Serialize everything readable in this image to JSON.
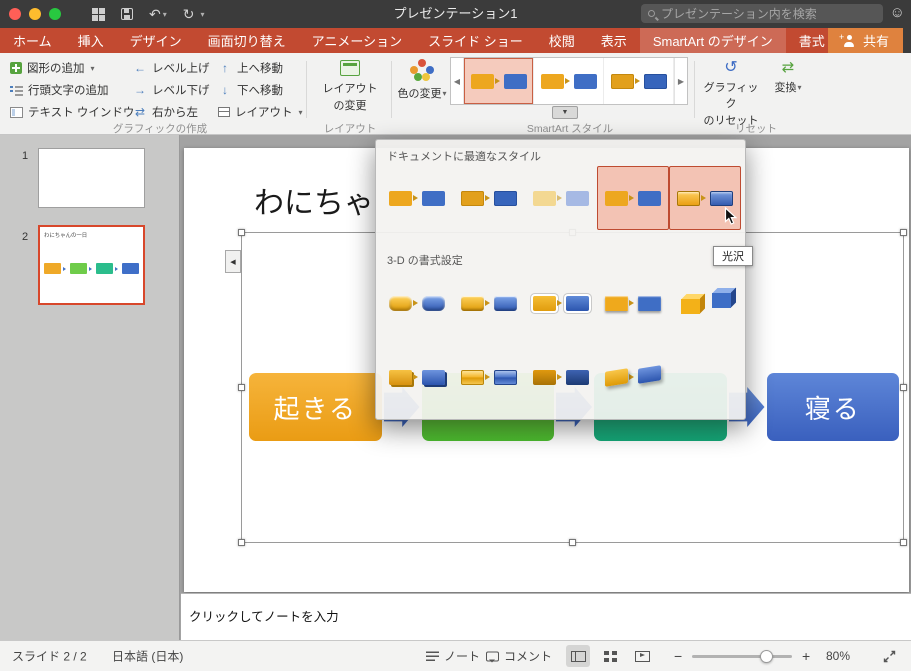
{
  "titlebar": {
    "title": "プレゼンテーション1",
    "search_placeholder": "プレゼンテーション内を検索"
  },
  "tabs": [
    {
      "id": "home",
      "label": "ホーム"
    },
    {
      "id": "insert",
      "label": "挿入"
    },
    {
      "id": "design",
      "label": "デザイン"
    },
    {
      "id": "transitions",
      "label": "画面切り替え"
    },
    {
      "id": "animations",
      "label": "アニメーション"
    },
    {
      "id": "slideshow",
      "label": "スライド ショー"
    },
    {
      "id": "review",
      "label": "校閲"
    },
    {
      "id": "view",
      "label": "表示"
    },
    {
      "id": "smartart-design",
      "label": "SmartArt のデザイン",
      "active": true
    },
    {
      "id": "format",
      "label": "書式"
    }
  ],
  "share_label": "共有",
  "ribbon": {
    "add_shape": "図形の追加",
    "add_bullet": "行頭文字の追加",
    "text_pane": "テキスト ウインドウ",
    "promote": "レベル上げ",
    "demote": "レベル下げ",
    "right_to_left": "右から左",
    "move_up": "上へ移動",
    "move_down": "下へ移動",
    "layout": "レイアウト",
    "change_layout_1": "レイアウト",
    "change_layout_2": "の変更",
    "change_colors": "色の変更",
    "reset_graphic_1": "グラフィック",
    "reset_graphic_2": "のリセット",
    "convert": "変換",
    "group_create": "グラフィックの作成",
    "group_layout": "レイアウト",
    "group_styles": "SmartArt スタイル",
    "group_reset": "リセット"
  },
  "gallery": {
    "items": [
      {
        "style": "vivid",
        "selected": true
      },
      {
        "style": "flat"
      },
      {
        "style": "flat2"
      }
    ]
  },
  "dropdown": {
    "section_best": "ドキュメントに最適なスタイル",
    "section_3d": "3-D の書式設定",
    "tooltip": "光沢",
    "best_styles": [
      {
        "style": "flat"
      },
      {
        "style": "flat2"
      },
      {
        "style": "subtle"
      },
      {
        "style": "vivid",
        "selected": true
      },
      {
        "style": "cartoon",
        "selected": true,
        "cursor": true
      }
    ],
    "threed_row1": [
      {
        "style": "bevel2"
      },
      {
        "style": "bevel"
      },
      {
        "style": "inset"
      },
      {
        "style": "bevelflat"
      },
      {
        "style": "cube"
      }
    ],
    "threed_row2": [
      {
        "style": "brick"
      },
      {
        "style": "gloss"
      },
      {
        "style": "dark"
      },
      {
        "style": "persp"
      }
    ]
  },
  "slides_panel": {
    "items": [
      {
        "number": "1",
        "selected": false
      },
      {
        "number": "2",
        "selected": true,
        "title": "わにちゃんの一日"
      }
    ],
    "mini_colors": [
      "#EFA928",
      "#6FCC4A",
      "#2BBD8C",
      "#3F6FC8"
    ]
  },
  "slide": {
    "title": "わにちゃ",
    "shapes": [
      {
        "kind": "box",
        "label": "起きる",
        "grad": [
          "#F6B43B",
          "#EA9C14"
        ]
      },
      {
        "kind": "arrow"
      },
      {
        "kind": "box",
        "label": "",
        "grad": [
          "#8FDE52",
          "#4CBD2F"
        ]
      },
      {
        "kind": "arrow"
      },
      {
        "kind": "box",
        "label": "",
        "grad": [
          "#44D49B",
          "#14A878"
        ]
      },
      {
        "kind": "arrow"
      },
      {
        "kind": "box",
        "label": "寝る",
        "grad": [
          "#5E86D8",
          "#3A60BE"
        ]
      }
    ]
  },
  "notes_placeholder": "クリックしてノートを入力",
  "statusbar": {
    "slide_indicator": "スライド 2 / 2",
    "language": "日本語 (日本)",
    "notes": "ノート",
    "comments": "コメント",
    "zoom_level": "80%"
  },
  "glyphs": {
    "caret": "▾",
    "tri_down": "▼",
    "tri_left": "◀",
    "tri_right": "▶",
    "undo": "↶",
    "redo": "↻",
    "reset": "↺",
    "swap": "⇄",
    "up": "↑",
    "down": "↓",
    "left": "←",
    "right": "→",
    "smiley": "☺",
    "plus": "+",
    "minus": "−"
  },
  "colors": {
    "accent_red": "#C24A31",
    "share_orange": "#DF823E",
    "selection_pink": "#F3C3B4",
    "selection_border": "#BE4B31",
    "thumb_selected_border": "#D8472B"
  }
}
